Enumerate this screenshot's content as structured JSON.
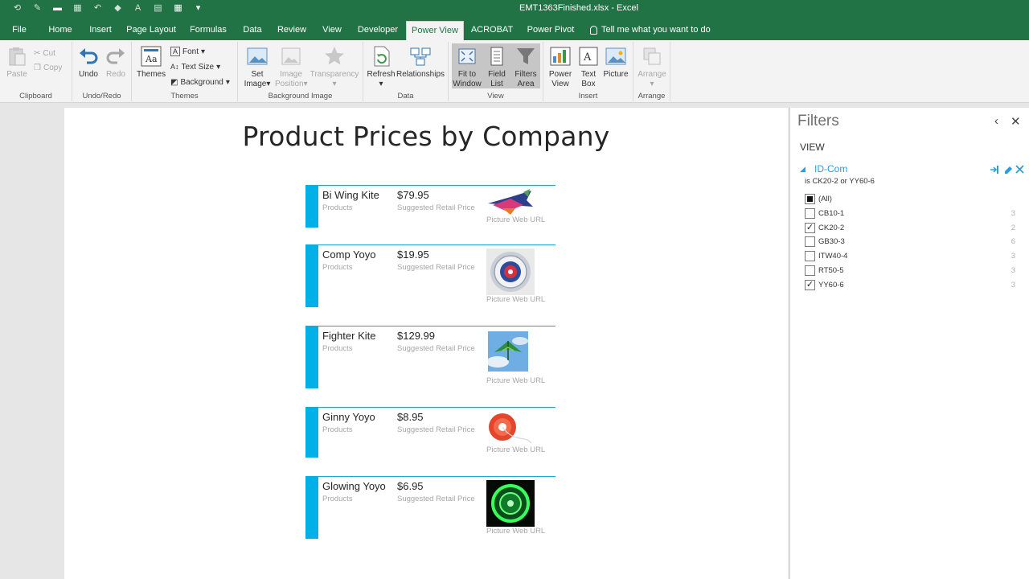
{
  "window": {
    "title": "EMT1363Finished.xlsx  -  Excel"
  },
  "tabs": [
    {
      "label": "File"
    },
    {
      "label": "Home"
    },
    {
      "label": "Insert"
    },
    {
      "label": "Page Layout"
    },
    {
      "label": "Formulas"
    },
    {
      "label": "Data"
    },
    {
      "label": "Review"
    },
    {
      "label": "View"
    },
    {
      "label": "Developer"
    },
    {
      "label": "Power View"
    },
    {
      "label": "ACROBAT"
    },
    {
      "label": "Power Pivot"
    }
  ],
  "tell_me": "Tell me what you want to do",
  "ribbon": {
    "clipboard": {
      "group": "Clipboard",
      "paste": "Paste",
      "cut": "Cut",
      "copy": "Copy"
    },
    "undo_redo": {
      "group": "Undo/Redo",
      "undo": "Undo",
      "redo": "Redo"
    },
    "themes": {
      "group": "Themes",
      "themes": "Themes",
      "font": "Font",
      "text_size": "Text Size",
      "background": "Background"
    },
    "background_image": {
      "group": "Background Image",
      "set_image_1": "Set",
      "set_image_2": "Image",
      "image_position_1": "Image",
      "image_position_2": "Position",
      "transparency": "Transparency"
    },
    "data": {
      "group": "Data",
      "refresh": "Refresh",
      "relationships": "Relationships"
    },
    "view": {
      "group": "View",
      "fit_1": "Fit to",
      "fit_2": "Window",
      "field_1": "Field",
      "field_2": "List",
      "filters_1": "Filters",
      "filters_2": "Area"
    },
    "insert": {
      "group": "Insert",
      "pv_1": "Power",
      "pv_2": "View",
      "tb_1": "Text",
      "tb_2": "Box",
      "picture": "Picture"
    },
    "arrange": {
      "group": "Arrange",
      "arrange": "Arrange"
    }
  },
  "report": {
    "title": "Product Prices by Company",
    "products_label": "Products",
    "srp_label": "Suggested Retail Price",
    "picture_label": "Picture Web URL",
    "cards": [
      {
        "name": "Bi Wing Kite",
        "price": "$79.95",
        "image": "biwing-kite"
      },
      {
        "name": "Comp Yoyo",
        "price": "$19.95",
        "image": "comp-yoyo"
      },
      {
        "name": "Fighter Kite",
        "price": "$129.99",
        "image": "fighter-kite"
      },
      {
        "name": "Ginny Yoyo",
        "price": "$8.95",
        "image": "ginny-yoyo"
      },
      {
        "name": "Glowing Yoyo",
        "price": "$6.95",
        "image": "glowing-yoyo"
      }
    ]
  },
  "filters": {
    "title": "Filters",
    "section": "VIEW",
    "field": "ID-Com",
    "description": "is CK20-2 or YY60-6",
    "options": [
      {
        "label": "(All)",
        "count": "",
        "state": "partial"
      },
      {
        "label": "CB10-1",
        "count": "3",
        "state": "off"
      },
      {
        "label": "CK20-2",
        "count": "2",
        "state": "on"
      },
      {
        "label": "GB30-3",
        "count": "6",
        "state": "off"
      },
      {
        "label": "ITW40-4",
        "count": "3",
        "state": "off"
      },
      {
        "label": "RT50-5",
        "count": "3",
        "state": "off"
      },
      {
        "label": "YY60-6",
        "count": "3",
        "state": "on"
      }
    ]
  },
  "colors": {
    "excel_green": "#217346",
    "accent_blue": "#00b0e6",
    "link_blue": "#26a0da"
  }
}
